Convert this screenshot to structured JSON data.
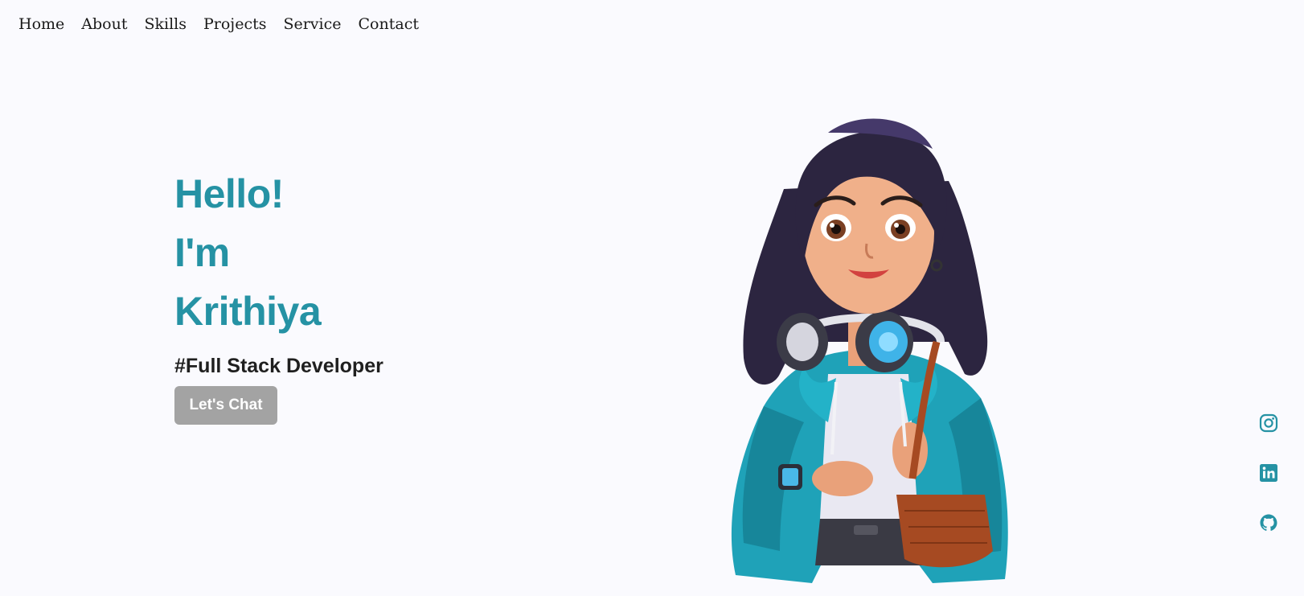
{
  "nav": {
    "items": [
      "Home",
      "About",
      "Skills",
      "Projects",
      "Service",
      "Contact"
    ]
  },
  "hero": {
    "line1": "Hello!",
    "line2": "I'm",
    "name": "Krithiya",
    "role": "#Full Stack Developer",
    "cta_label": "Let's Chat"
  },
  "socials": {
    "icons": [
      "instagram-icon",
      "linkedin-icon",
      "github-icon"
    ]
  },
  "colors": {
    "accent": "#2592a4",
    "background": "#fafafe",
    "button": "#a3a3a3",
    "text": "#1f1f1f"
  }
}
